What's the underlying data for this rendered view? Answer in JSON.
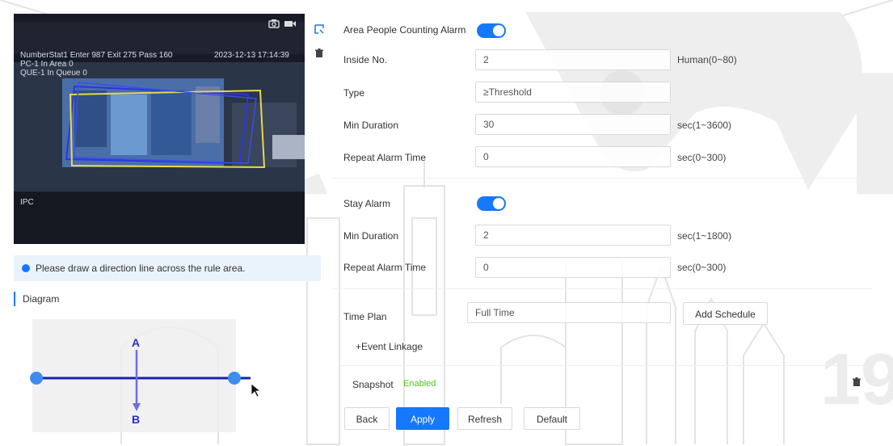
{
  "video": {
    "osd_line1": "NumberStat1 Enter 987 Exit 275 Pass 160",
    "osd_line2": "PC-1 In Area 0",
    "osd_line3": "QUE-1 In Queue 0",
    "timestamp": "2023-12-13 17:14:39",
    "channel_label": "IPC",
    "snapshot_icon": "camera-icon",
    "record_icon": "video-record-icon"
  },
  "tools": {
    "draw_icon": "draw-rule-icon",
    "delete_icon": "trash-icon"
  },
  "tip": {
    "text": "Please draw a direction line across the rule area."
  },
  "diagram": {
    "title": "Diagram",
    "label_a": "A",
    "label_b": "B"
  },
  "form": {
    "area_alarm": {
      "label": "Area People Counting Alarm",
      "enabled": true
    },
    "inside_no": {
      "label": "Inside No.",
      "value": "2",
      "unit": "Human(0~80)"
    },
    "type": {
      "label": "Type",
      "value": "≥Threshold"
    },
    "min_duration": {
      "label": "Min Duration",
      "value": "30",
      "unit": "sec(1~3600)"
    },
    "repeat_alarm": {
      "label": "Repeat Alarm Time",
      "value": "0",
      "unit": "sec(0~300)"
    },
    "stay_alarm": {
      "label": "Stay Alarm",
      "enabled": true
    },
    "stay_min_duration": {
      "label": "Min Duration",
      "value": "2",
      "unit": "sec(1~1800)"
    },
    "stay_repeat_alarm": {
      "label": "Repeat Alarm Time",
      "value": "0",
      "unit": "sec(0~300)"
    },
    "time_plan": {
      "label": "Time Plan",
      "value": "Full Time",
      "add_schedule": "Add Schedule"
    },
    "event_linkage": "+Event Linkage",
    "snapshot": {
      "label": "Snapshot",
      "status": "Enabled"
    }
  },
  "buttons": {
    "back": "Back",
    "apply": "Apply",
    "refresh": "Refresh",
    "default": "Default"
  },
  "colors": {
    "accent": "#1677ff",
    "enabled_text": "#52c41a"
  }
}
